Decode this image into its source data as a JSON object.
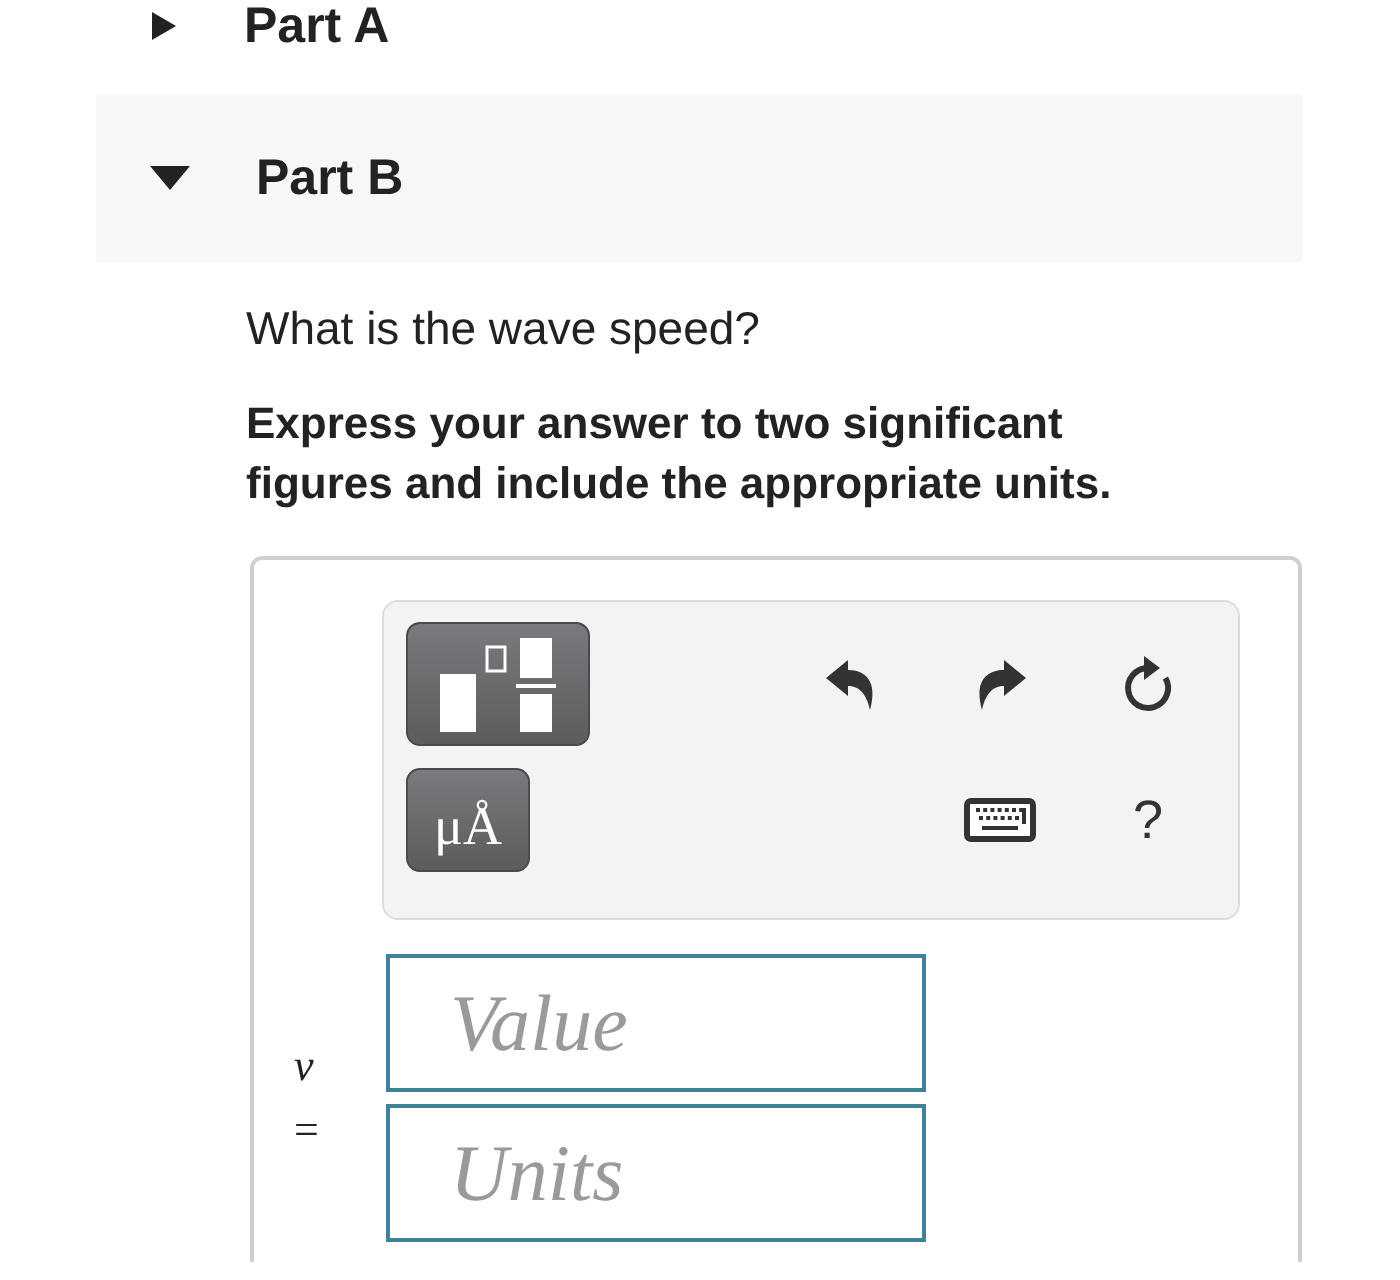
{
  "parts": [
    {
      "label": "Part A",
      "expanded": false
    },
    {
      "label": "Part B",
      "expanded": true,
      "prompt": "What is the wave speed?",
      "instructions": "Express your answer to two significant figures and include the appropriate units.",
      "toolbar": {
        "units_label": "μÅ",
        "help_label": "?"
      },
      "answer": {
        "variable": "v",
        "relation": "=",
        "fields": [
          {
            "placeholder": "Value"
          },
          {
            "placeholder": "Units"
          }
        ]
      }
    }
  ]
}
